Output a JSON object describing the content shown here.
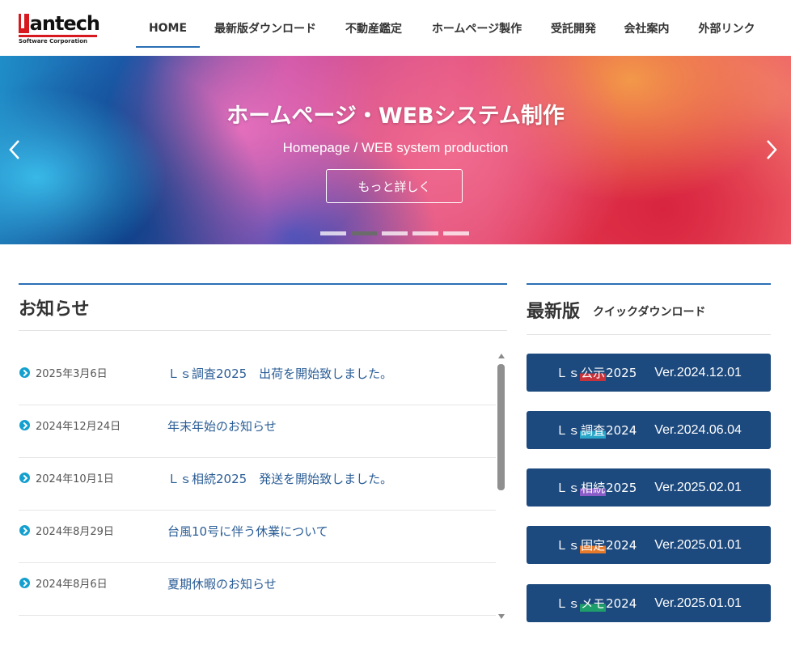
{
  "header": {
    "logo": {
      "word": "antech",
      "subtitle": "Software Corporation"
    },
    "nav": [
      {
        "label": "HOME",
        "active": true
      },
      {
        "label": "最新版ダウンロード",
        "active": false
      },
      {
        "label": "不動産鑑定",
        "active": false
      },
      {
        "label": "ホームページ製作",
        "active": false
      },
      {
        "label": "受託開発",
        "active": false
      },
      {
        "label": "会社案内",
        "active": false
      },
      {
        "label": "外部リンク",
        "active": false
      }
    ]
  },
  "hero": {
    "title": "ホームページ・WEBシステム制作",
    "subtitle": "Homepage / WEB system production",
    "button_label": "もっと詳しく",
    "slide_count": 5,
    "active_slide": 2
  },
  "notices": {
    "title": "お知らせ",
    "items": [
      {
        "date": "2025年3月6日",
        "text": "Ｌｓ調査2025　出荷を開始致しました。"
      },
      {
        "date": "2024年12月24日",
        "text": "年末年始のお知らせ"
      },
      {
        "date": "2024年10月1日",
        "text": "Ｌｓ相続2025　発送を開始致しました。"
      },
      {
        "date": "2024年8月29日",
        "text": "台風10号に伴う休業について"
      },
      {
        "date": "2024年8月6日",
        "text": "夏期休暇のお知らせ"
      }
    ]
  },
  "downloads": {
    "title": "最新版",
    "subtitle": "クイックダウンロード",
    "items": [
      {
        "prefix": "Ｌｓ",
        "name": "公示",
        "year": "2025",
        "version": "Ver.2024.12.01",
        "accent": "#c8323a"
      },
      {
        "prefix": "Ｌｓ",
        "name": "調査",
        "year": "2024",
        "version": "Ver.2024.06.04",
        "accent": "#2aa6c9"
      },
      {
        "prefix": "Ｌｓ",
        "name": "相続",
        "year": "2025",
        "version": "Ver.2025.02.01",
        "accent": "#8a5cc8"
      },
      {
        "prefix": "Ｌｓ",
        "name": "固定",
        "year": "2024",
        "version": "Ver.2025.01.01",
        "accent": "#e77a2a"
      },
      {
        "prefix": "Ｌｓ",
        "name": "メモ",
        "year": "2024",
        "version": "Ver.2025.01.01",
        "accent": "#1e9e6a"
      }
    ]
  },
  "colors": {
    "accent_blue": "#2a6fb4",
    "button_navy": "#1d4a7e",
    "logo_red": "#d7191f",
    "link_blue": "#2a5d96"
  }
}
